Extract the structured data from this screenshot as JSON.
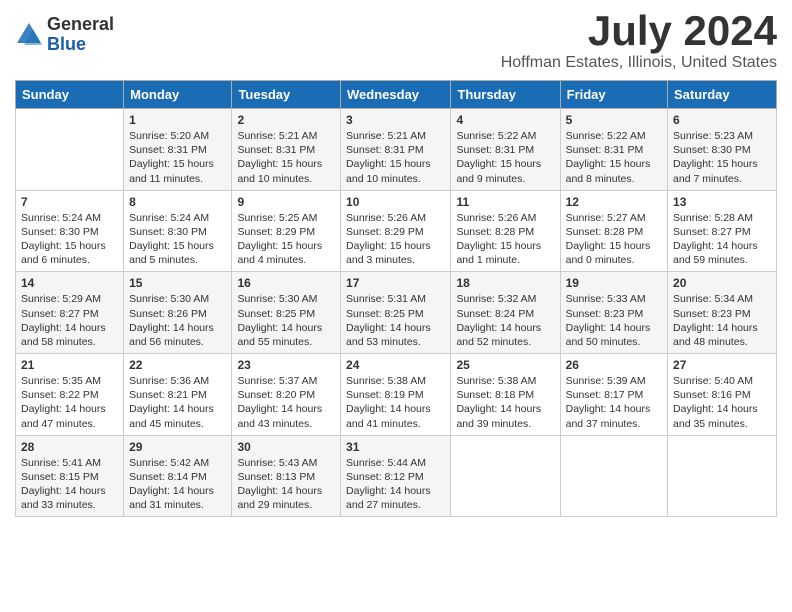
{
  "logo": {
    "general": "General",
    "blue": "Blue"
  },
  "title": {
    "month": "July 2024",
    "location": "Hoffman Estates, Illinois, United States"
  },
  "headers": [
    "Sunday",
    "Monday",
    "Tuesday",
    "Wednesday",
    "Thursday",
    "Friday",
    "Saturday"
  ],
  "weeks": [
    [
      {
        "day": "",
        "info": ""
      },
      {
        "day": "1",
        "info": "Sunrise: 5:20 AM\nSunset: 8:31 PM\nDaylight: 15 hours\nand 11 minutes."
      },
      {
        "day": "2",
        "info": "Sunrise: 5:21 AM\nSunset: 8:31 PM\nDaylight: 15 hours\nand 10 minutes."
      },
      {
        "day": "3",
        "info": "Sunrise: 5:21 AM\nSunset: 8:31 PM\nDaylight: 15 hours\nand 10 minutes."
      },
      {
        "day": "4",
        "info": "Sunrise: 5:22 AM\nSunset: 8:31 PM\nDaylight: 15 hours\nand 9 minutes."
      },
      {
        "day": "5",
        "info": "Sunrise: 5:22 AM\nSunset: 8:31 PM\nDaylight: 15 hours\nand 8 minutes."
      },
      {
        "day": "6",
        "info": "Sunrise: 5:23 AM\nSunset: 8:30 PM\nDaylight: 15 hours\nand 7 minutes."
      }
    ],
    [
      {
        "day": "7",
        "info": "Sunrise: 5:24 AM\nSunset: 8:30 PM\nDaylight: 15 hours\nand 6 minutes."
      },
      {
        "day": "8",
        "info": "Sunrise: 5:24 AM\nSunset: 8:30 PM\nDaylight: 15 hours\nand 5 minutes."
      },
      {
        "day": "9",
        "info": "Sunrise: 5:25 AM\nSunset: 8:29 PM\nDaylight: 15 hours\nand 4 minutes."
      },
      {
        "day": "10",
        "info": "Sunrise: 5:26 AM\nSunset: 8:29 PM\nDaylight: 15 hours\nand 3 minutes."
      },
      {
        "day": "11",
        "info": "Sunrise: 5:26 AM\nSunset: 8:28 PM\nDaylight: 15 hours\nand 1 minute."
      },
      {
        "day": "12",
        "info": "Sunrise: 5:27 AM\nSunset: 8:28 PM\nDaylight: 15 hours\nand 0 minutes."
      },
      {
        "day": "13",
        "info": "Sunrise: 5:28 AM\nSunset: 8:27 PM\nDaylight: 14 hours\nand 59 minutes."
      }
    ],
    [
      {
        "day": "14",
        "info": "Sunrise: 5:29 AM\nSunset: 8:27 PM\nDaylight: 14 hours\nand 58 minutes."
      },
      {
        "day": "15",
        "info": "Sunrise: 5:30 AM\nSunset: 8:26 PM\nDaylight: 14 hours\nand 56 minutes."
      },
      {
        "day": "16",
        "info": "Sunrise: 5:30 AM\nSunset: 8:25 PM\nDaylight: 14 hours\nand 55 minutes."
      },
      {
        "day": "17",
        "info": "Sunrise: 5:31 AM\nSunset: 8:25 PM\nDaylight: 14 hours\nand 53 minutes."
      },
      {
        "day": "18",
        "info": "Sunrise: 5:32 AM\nSunset: 8:24 PM\nDaylight: 14 hours\nand 52 minutes."
      },
      {
        "day": "19",
        "info": "Sunrise: 5:33 AM\nSunset: 8:23 PM\nDaylight: 14 hours\nand 50 minutes."
      },
      {
        "day": "20",
        "info": "Sunrise: 5:34 AM\nSunset: 8:23 PM\nDaylight: 14 hours\nand 48 minutes."
      }
    ],
    [
      {
        "day": "21",
        "info": "Sunrise: 5:35 AM\nSunset: 8:22 PM\nDaylight: 14 hours\nand 47 minutes."
      },
      {
        "day": "22",
        "info": "Sunrise: 5:36 AM\nSunset: 8:21 PM\nDaylight: 14 hours\nand 45 minutes."
      },
      {
        "day": "23",
        "info": "Sunrise: 5:37 AM\nSunset: 8:20 PM\nDaylight: 14 hours\nand 43 minutes."
      },
      {
        "day": "24",
        "info": "Sunrise: 5:38 AM\nSunset: 8:19 PM\nDaylight: 14 hours\nand 41 minutes."
      },
      {
        "day": "25",
        "info": "Sunrise: 5:38 AM\nSunset: 8:18 PM\nDaylight: 14 hours\nand 39 minutes."
      },
      {
        "day": "26",
        "info": "Sunrise: 5:39 AM\nSunset: 8:17 PM\nDaylight: 14 hours\nand 37 minutes."
      },
      {
        "day": "27",
        "info": "Sunrise: 5:40 AM\nSunset: 8:16 PM\nDaylight: 14 hours\nand 35 minutes."
      }
    ],
    [
      {
        "day": "28",
        "info": "Sunrise: 5:41 AM\nSunset: 8:15 PM\nDaylight: 14 hours\nand 33 minutes."
      },
      {
        "day": "29",
        "info": "Sunrise: 5:42 AM\nSunset: 8:14 PM\nDaylight: 14 hours\nand 31 minutes."
      },
      {
        "day": "30",
        "info": "Sunrise: 5:43 AM\nSunset: 8:13 PM\nDaylight: 14 hours\nand 29 minutes."
      },
      {
        "day": "31",
        "info": "Sunrise: 5:44 AM\nSunset: 8:12 PM\nDaylight: 14 hours\nand 27 minutes."
      },
      {
        "day": "",
        "info": ""
      },
      {
        "day": "",
        "info": ""
      },
      {
        "day": "",
        "info": ""
      }
    ]
  ]
}
